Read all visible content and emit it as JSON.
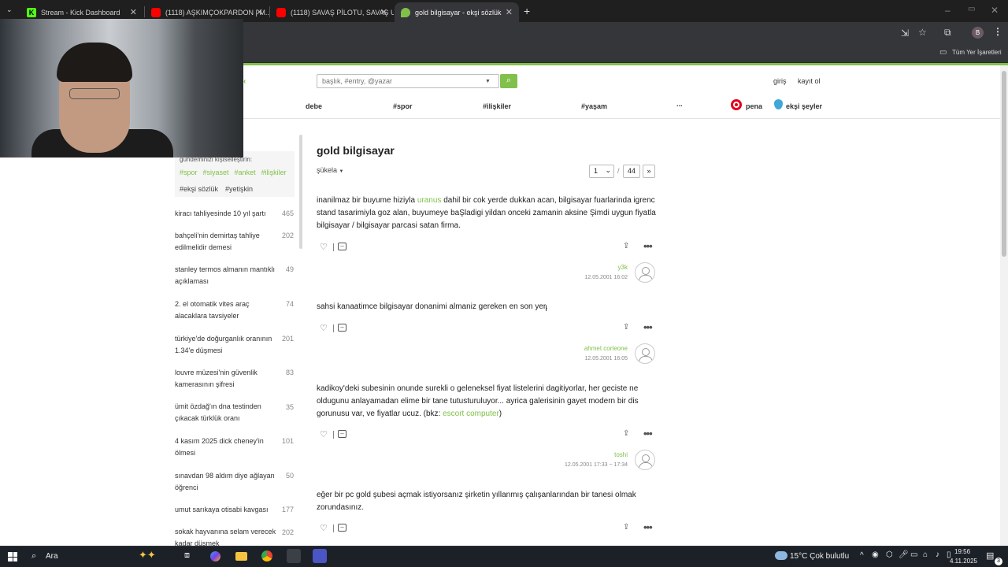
{
  "browser": {
    "tabs": [
      {
        "title": "Stream - Kick Dashboard",
        "color": "#53fc18"
      },
      {
        "title": "(1118) AŞKIMÇOKPARDON | M...",
        "color": "#ff0000"
      },
      {
        "title": "(1118) SAVAŞ PİLOTU, SAVAŞ U...",
        "color": "#ff0000"
      },
      {
        "title": "gold bilgisayar - ekşi sözlük",
        "color": "#81c14b"
      }
    ],
    "bookmarks_label": "Tüm Yer İşaretleri",
    "profile_initial": "B"
  },
  "site": {
    "search_placeholder": "başlık, #entry, @yazar",
    "login": "giriş",
    "register": "kayıt ol",
    "nav": [
      "debe",
      "#spor",
      "#ilişkiler",
      "#yaşam",
      "...",
      "pena",
      "ekşi şeyler"
    ],
    "accent_color": "#81c14b"
  },
  "sidebar": {
    "personalize": "gündeminizi kişiselleştirin:",
    "tags": [
      "#spor",
      "#siyaset",
      "#anket",
      "#ilişkiler"
    ],
    "tags2": [
      "#ekşi sözlük",
      "#yetişkin"
    ],
    "topics": [
      {
        "title": "kiracı tahliyesinde 10 yıl şartı",
        "count": "465"
      },
      {
        "title": "bahçeli'nin demirtaş tahliye edilmelidir demesi",
        "count": "202"
      },
      {
        "title": "stanley termos almanın mantıklı açıklaması",
        "count": "49"
      },
      {
        "title": "2. el otomatik vites araç alacaklara tavsiyeler",
        "count": "74"
      },
      {
        "title": "türkiye'de doğurganlık oranının 1.34'e düşmesi",
        "count": "201"
      },
      {
        "title": "louvre müzesi'nin güvenlik kamerasının şifresi",
        "count": "83"
      },
      {
        "title": "ümit özdağ'ın dna testinden çıkacak türklük oranı",
        "count": "35"
      },
      {
        "title": "4 kasım 2025 dick cheney'in ölmesi",
        "count": "101"
      },
      {
        "title": "sınavdan 98 aldım diye ağlayan öğrenci",
        "count": "50"
      },
      {
        "title": "umut sarıkaya otisabi kavgası",
        "count": "177"
      },
      {
        "title": "sokak hayvanına selam verecek kadar düşmek",
        "count": "202"
      }
    ]
  },
  "topic": {
    "title": "gold bilgisayar",
    "sort": "şükela",
    "page": "1",
    "total_pages": "44",
    "next": "»"
  },
  "entries": [
    {
      "text_before": "inanilmaz bir buyume hiziyla ",
      "link": "uranus",
      "text_after": " dahil bir cok yerde dukkan acan, bilgisayar fuarlarinda igrenc stand tasarimiyla goz alan, buyumeye baŞladigi yildan onceki zamanin aksine Şimdi uygun fiyatla bilgisayar / bilgisayar parcasi satan firma.",
      "author": "y3k",
      "date": "12.05.2001 16:02"
    },
    {
      "text_before": "sahsi kanaatimce bilgisayar donanimi almaniz gereken en son yer.",
      "link": "",
      "text_after": "",
      "author": "ahmet corleone",
      "date": "12.05.2001 16:05"
    },
    {
      "text_before": "kadikoy'deki subesinin onunde surekli o geleneksel fiyat listelerini dagitiyorlar, her geciste ne oldugunu anlayamadan elime bir tane tutusturuluyor... ayrica galerisinin gayet modern bir dis gorunusu var, ve fiyatlar ucuz. (bkz: ",
      "link": "escort computer",
      "text_after": ")",
      "author": "toshi",
      "date": "12.05.2001 17:33 ~ 17:34"
    },
    {
      "text_before": "eğer bir pc gold şubesi açmak istiyorsanız şirketin yıllanmış çalışanlarından bir tanesi olmak zorundasınız.",
      "link": "",
      "text_after": "",
      "author": "",
      "date": ""
    }
  ],
  "taskbar": {
    "search": "Ara",
    "weather": "15°C  Çok bulutlu",
    "time": "19:56",
    "date": "4.11.2025",
    "notifications": "3"
  }
}
